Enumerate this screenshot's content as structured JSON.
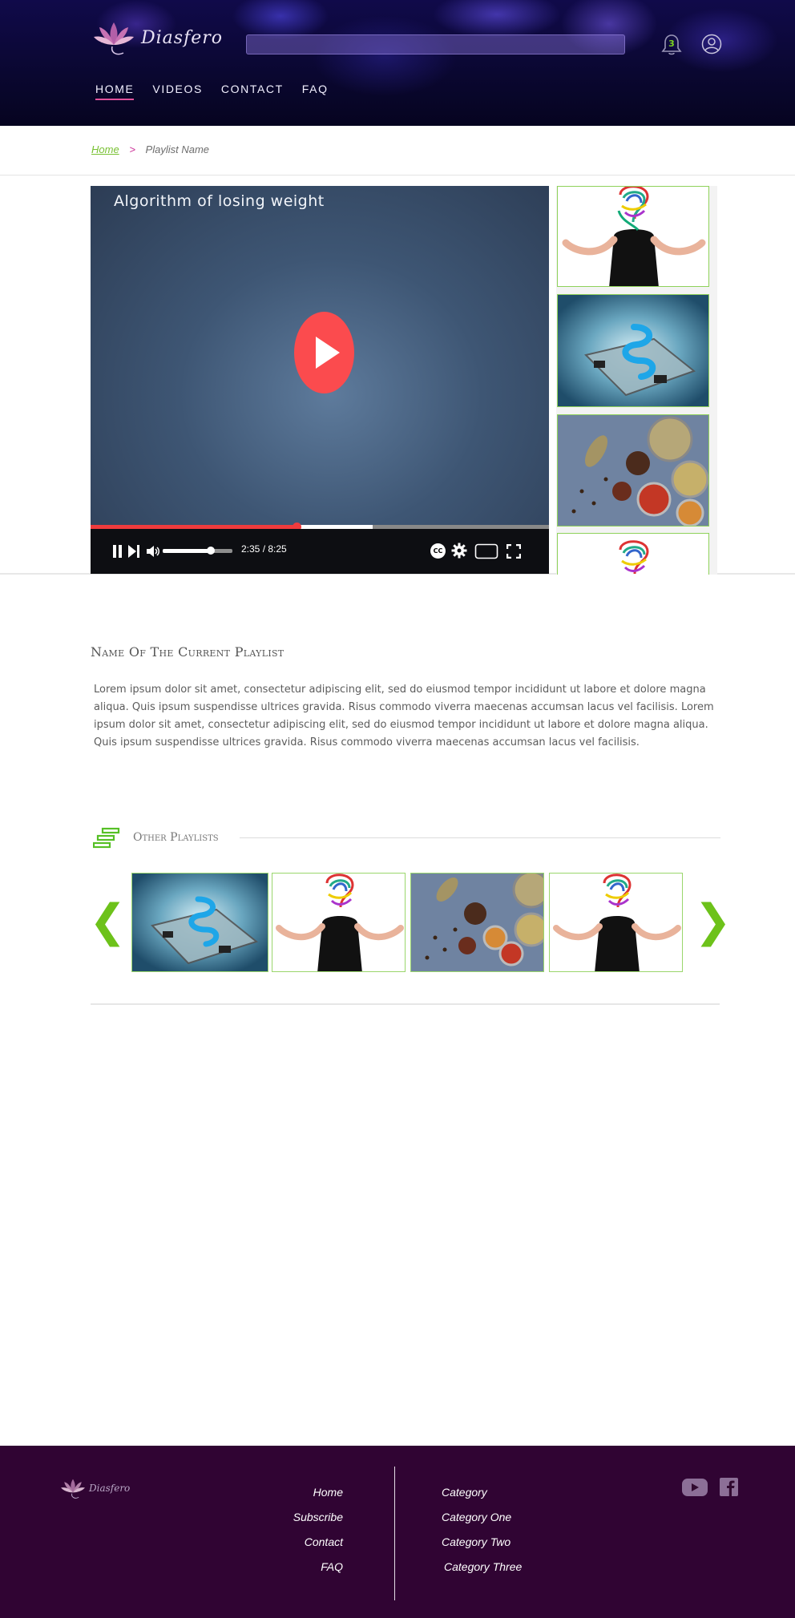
{
  "header": {
    "logo_text": "Diasfero",
    "search_placeholder": "",
    "notification_count": "3",
    "nav": [
      {
        "label": "HOME"
      },
      {
        "label": "VIDEOS"
      },
      {
        "label": "CONTACT"
      },
      {
        "label": "FAQ"
      }
    ]
  },
  "breadcrumb": {
    "home": "Home",
    "separator": ">",
    "current": "Playlist Name"
  },
  "player": {
    "title": "Algorithm of losing weight",
    "time": "2:35 / 8:25",
    "played_fraction": 0.45,
    "buffered_fraction": 0.615,
    "volume_fraction": 0.69,
    "cc_label": "CC"
  },
  "playlist": {
    "title": "Name Of The Current Playlist",
    "description": "Lorem ipsum dolor sit amet, consectetur adipiscing elit, sed do eiusmod tempor incididunt ut labore et dolore magna aliqua. Quis ipsum suspendisse ultrices gravida. Risus commodo viverra maecenas accumsan lacus vel facilisis. Lorem ipsum dolor sit amet, consectetur adipiscing elit, sed do eiusmod tempor incididunt ut labore et dolore magna aliqua. Quis ipsum suspendisse ultrices gravida. Risus commodo viverra maecenas accumsan lacus vel facilisis."
  },
  "other_playlists": {
    "title": "Other Playlists",
    "prev": "❮",
    "next": "❯"
  },
  "footer": {
    "logo_text": "Diasfero",
    "links_left": [
      "Home",
      "Subscribe",
      "Contact",
      "FAQ"
    ],
    "links_right": [
      "Category",
      "Category One",
      "Category Two",
      "Category Three"
    ]
  },
  "colors": {
    "accent_green": "#79c133",
    "accent_pink": "#cc2e96",
    "player_red": "#ef3b3d",
    "footer_bg": "#300433"
  }
}
